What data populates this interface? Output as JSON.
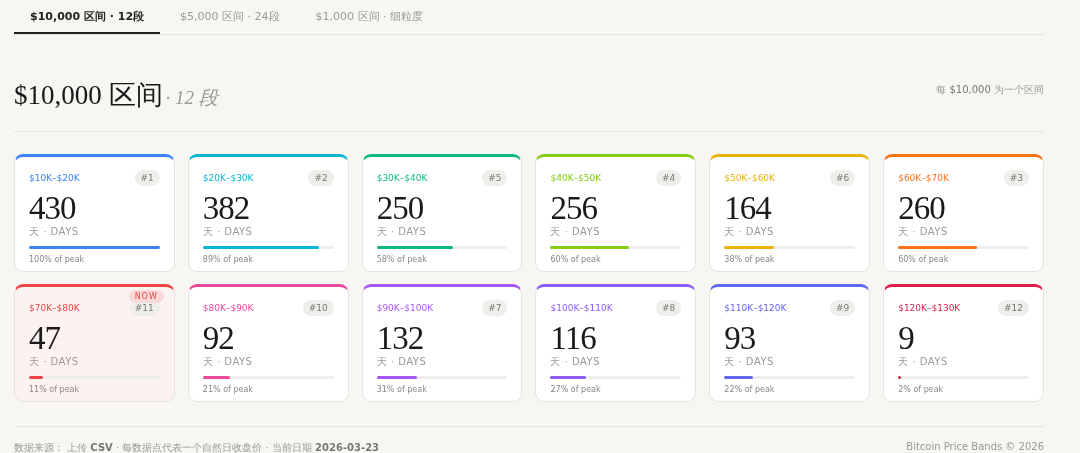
{
  "tabs": [
    {
      "label": "$10,000 区间 · 12段",
      "selected": true
    },
    {
      "label": "$5,000 区间 · 24段",
      "selected": false
    },
    {
      "label": "$1,000 区间 · 细粒度",
      "selected": false
    }
  ],
  "heading": {
    "title": "$10,000 区间",
    "suffix": "· 12 段",
    "note": "每 **$10,000** 为一个区间"
  },
  "bands": [
    {
      "range": "$10K–$20K",
      "rank": "#1",
      "days": "430",
      "unit": "天 · DAYS",
      "level": 1.0,
      "peak": "100% of peak",
      "color": "#3b82f6",
      "current": false
    },
    {
      "range": "$20K–$30K",
      "rank": "#2",
      "days": "382",
      "unit": "天 · DAYS",
      "level": 0.89,
      "peak": "89% of peak",
      "color": "#06b6d4",
      "current": false
    },
    {
      "range": "$30K–$40K",
      "rank": "#5",
      "days": "250",
      "unit": "天 · DAYS",
      "level": 0.58,
      "peak": "58% of peak",
      "color": "#10b981",
      "current": false
    },
    {
      "range": "$40K–$50K",
      "rank": "#4",
      "days": "256",
      "unit": "天 · DAYS",
      "level": 0.6,
      "peak": "60% of peak",
      "color": "#84cc16",
      "current": false
    },
    {
      "range": "$50K–$60K",
      "rank": "#6",
      "days": "164",
      "unit": "天 · DAYS",
      "level": 0.38,
      "peak": "38% of peak",
      "color": "#eab308",
      "current": false
    },
    {
      "range": "$60K–$70K",
      "rank": "#3",
      "days": "260",
      "unit": "天 · DAYS",
      "level": 0.6,
      "peak": "60% of peak",
      "color": "#f97316",
      "current": false
    },
    {
      "range": "$70K–$80K",
      "rank": "#11",
      "days": "47",
      "unit": "天 · DAYS",
      "level": 0.11,
      "peak": "11% of peak",
      "color": "#ef4444",
      "current": true,
      "badge": "NOW"
    },
    {
      "range": "$80K–$90K",
      "rank": "#10",
      "days": "92",
      "unit": "天 · DAYS",
      "level": 0.21,
      "peak": "21% of peak",
      "color": "#ec4899",
      "current": false
    },
    {
      "range": "$90K–$100K",
      "rank": "#7",
      "days": "132",
      "unit": "天 · DAYS",
      "level": 0.31,
      "peak": "31% of peak",
      "color": "#a855f7",
      "current": false
    },
    {
      "range": "$100K–$110K",
      "rank": "#8",
      "days": "116",
      "unit": "天 · DAYS",
      "level": 0.27,
      "peak": "27% of peak",
      "color": "#8b5cf6",
      "current": false
    },
    {
      "range": "$110K–$120K",
      "rank": "#9",
      "days": "93",
      "unit": "天 · DAYS",
      "level": 0.22,
      "peak": "22% of peak",
      "color": "#6366f1",
      "current": false
    },
    {
      "range": "$120K–$130K",
      "rank": "#12",
      "days": "9",
      "unit": "天 · DAYS",
      "level": 0.02,
      "peak": "2% of peak",
      "color": "#e11d48",
      "current": false
    }
  ],
  "footer": {
    "source": "数据来源：  上传 **CSV** · 每数据点代表一个自然日收盘价 · 当前日期 **2026-03-23**",
    "brand": "Bitcoin Price Bands © 2026"
  }
}
